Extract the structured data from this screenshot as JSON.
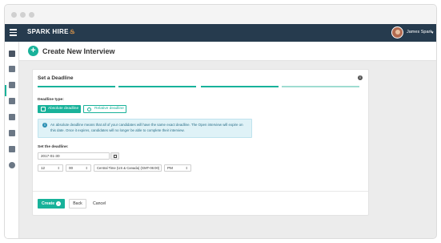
{
  "topbar": {
    "logo": "SPARK HIRE",
    "user_name": "James Spark"
  },
  "sidebar": {
    "items": [
      "video-icon",
      "briefcase-icon",
      "calendar-icon",
      "people-icon",
      "folder-icon",
      "chart-icon",
      "flag-icon",
      "help-icon"
    ]
  },
  "header": {
    "title": "Create New Interview",
    "add_icon": "+"
  },
  "card": {
    "title": "Set a Deadline",
    "steps_total": 4,
    "steps_active": 3,
    "deadline_type_label": "Deadline type:",
    "absolute_label": "Absolute deadline",
    "relative_label": "Relative deadline",
    "alert_text": "An absolute deadline means that all of your candidates will have the same exact deadline. The Open interview will expire on this date. Once it expires, candidates will no longer be able to complete their interview.",
    "set_deadline_label": "Set the deadline:",
    "date_value": "2017-01-30",
    "hour_value": "12",
    "minute_value": "00",
    "timezone_value": "Central Time (US & Canada) (GMT-06:00)",
    "ampm_value": "PM",
    "create_label": "Create",
    "back_label": "Back",
    "cancel_label": "Cancel"
  },
  "colors": {
    "accent": "#18b29a",
    "topbar": "#263b4e",
    "alert_bg": "#dff2f7"
  }
}
